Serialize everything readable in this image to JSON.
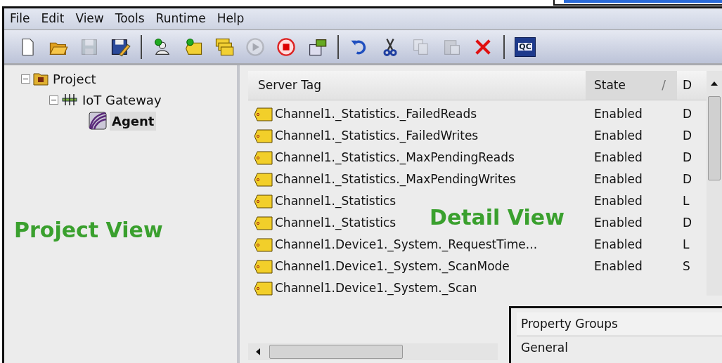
{
  "menu": [
    "File",
    "Edit",
    "View",
    "Tools",
    "Runtime",
    "Help"
  ],
  "toolbar": [
    {
      "kind": "new",
      "disabled": false
    },
    {
      "kind": "open",
      "disabled": false
    },
    {
      "kind": "save",
      "disabled": true
    },
    {
      "kind": "saveas",
      "disabled": false
    },
    {
      "kind": "sep"
    },
    {
      "kind": "addclient",
      "disabled": false
    },
    {
      "kind": "addtag",
      "disabled": false
    },
    {
      "kind": "addgroup",
      "disabled": false
    },
    {
      "kind": "start",
      "disabled": true
    },
    {
      "kind": "stop",
      "disabled": false
    },
    {
      "kind": "props",
      "disabled": false
    },
    {
      "kind": "sep"
    },
    {
      "kind": "undo",
      "disabled": false
    },
    {
      "kind": "cut",
      "disabled": false
    },
    {
      "kind": "copy",
      "disabled": true
    },
    {
      "kind": "paste",
      "disabled": true
    },
    {
      "kind": "delete",
      "disabled": false
    },
    {
      "kind": "sep"
    },
    {
      "kind": "qc",
      "label": "QC",
      "disabled": false
    }
  ],
  "tree": [
    {
      "label": "Project",
      "kind": "project",
      "expanded": true,
      "selected": false,
      "children": [
        {
          "label": "IoT Gateway",
          "kind": "gateway",
          "expanded": true,
          "selected": false,
          "children": [
            {
              "label": "Agent",
              "kind": "agent",
              "selected": true
            }
          ]
        }
      ]
    }
  ],
  "project_annotation": "Project View",
  "detail_annotation": "Detail View",
  "table": {
    "columns": [
      "Server Tag",
      "State",
      "D"
    ],
    "sort_mark": "/",
    "rows": [
      {
        "tag": "Channel1._Statistics._FailedReads",
        "state": "Enabled",
        "column_3": "D"
      },
      {
        "tag": "Channel1._Statistics._FailedWrites",
        "state": "Enabled",
        "column_3": "D"
      },
      {
        "tag": "Channel1._Statistics._MaxPendingReads",
        "state": "Enabled",
        "column_3": "D"
      },
      {
        "tag": "Channel1._Statistics._MaxPendingWrites",
        "state": "Enabled",
        "column_3": "D"
      },
      {
        "tag": "Channel1._Statistics",
        "state": "Enabled",
        "column_3": "L"
      },
      {
        "tag": "Channel1._Statistics",
        "state": "Enabled",
        "column_3": "D"
      },
      {
        "tag": "Channel1.Device1._System._RequestTime...",
        "state": "Enabled",
        "column_3": "L"
      },
      {
        "tag": "Channel1.Device1._System._ScanMode",
        "state": "Enabled",
        "column_3": "S"
      },
      {
        "tag": "Channel1.Device1._System._Scan"
      }
    ]
  },
  "property_panel": {
    "title": "Property Groups",
    "items": [
      "General"
    ]
  }
}
